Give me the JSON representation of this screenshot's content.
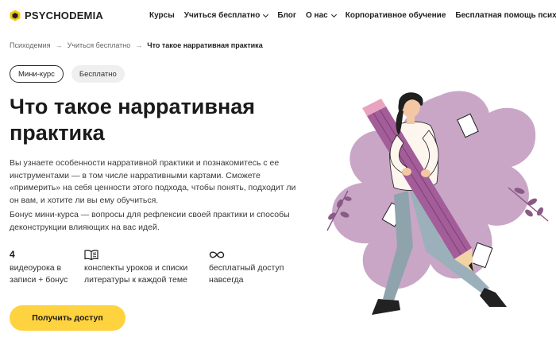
{
  "header": {
    "brand": "PSYCHODEMIA",
    "nav": [
      {
        "label": "Курсы",
        "has_dropdown": false
      },
      {
        "label": "Учиться бесплатно",
        "has_dropdown": true
      },
      {
        "label": "Блог",
        "has_dropdown": false
      },
      {
        "label": "О нас",
        "has_dropdown": true
      },
      {
        "label": "Корпоративное обучение",
        "has_dropdown": false
      },
      {
        "label": "Бесплатная помощь психолога",
        "has_dropdown": false
      }
    ]
  },
  "breadcrumb": {
    "items": [
      "Психодемия",
      "Учиться бесплатно"
    ],
    "separator": "→",
    "current": "Что такое нарративная практика"
  },
  "tags": [
    "Мини-курс",
    "Бесплатно"
  ],
  "hero": {
    "title": "Что такое нарративная практика",
    "description": "Вы узнаете особенности нарративной практики и познакомитесь с ее инструментами — в том числе нарративными картами. Сможете «примерить» на себя ценности этого подхода, чтобы понять, подходит ли он вам, и хотите ли вы ему обучиться.",
    "bonus": "Бонус мини-курса — вопросы для рефлексии своей практики и способы деконструкции влияющих на вас идей."
  },
  "features": [
    {
      "number": "4",
      "text": "видеоурока в записи + бонус",
      "icon": null
    },
    {
      "number": null,
      "text": "конспекты уроков и списки литературы к каждой теме",
      "icon": "open-book-icon"
    },
    {
      "number": null,
      "text": "бесплатный доступ навсегда",
      "icon": "infinity-icon"
    }
  ],
  "cta": {
    "label": "Получить доступ"
  },
  "colors": {
    "accent": "#ffd23f",
    "blob": "#c9a6c6",
    "pencil": "#a35d99",
    "logo": "#f5c518"
  }
}
